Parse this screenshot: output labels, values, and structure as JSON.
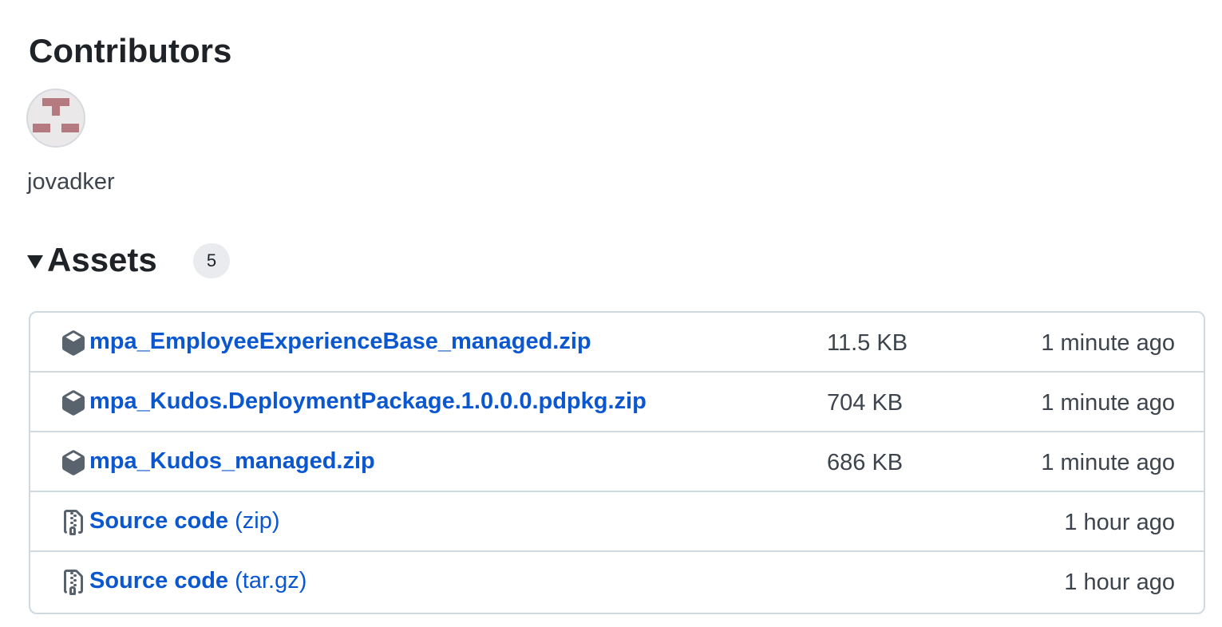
{
  "contributors": {
    "title": "Contributors",
    "people": [
      {
        "username": "jovadker",
        "avatar_icon": "identicon"
      }
    ]
  },
  "assets": {
    "title": "Assets",
    "count": "5",
    "expanded": true,
    "items": [
      {
        "name": "mpa_EmployeeExperienceBase_managed.zip",
        "suffix": "",
        "size": "11.5 KB",
        "time": "1 minute ago",
        "icon": "package-icon"
      },
      {
        "name": "mpa_Kudos.DeploymentPackage.1.0.0.0.pdpkg.zip",
        "suffix": "",
        "size": "704 KB",
        "time": "1 minute ago",
        "icon": "package-icon"
      },
      {
        "name": "mpa_Kudos_managed.zip",
        "suffix": "",
        "size": "686 KB",
        "time": "1 minute ago",
        "icon": "package-icon"
      },
      {
        "name": "Source code",
        "suffix": "(zip)",
        "size": "",
        "time": "1 hour ago",
        "icon": "file-zip-icon"
      },
      {
        "name": "Source code",
        "suffix": "(tar.gz)",
        "size": "",
        "time": "1 hour ago",
        "icon": "file-zip-icon"
      }
    ]
  },
  "colors": {
    "link": "#0b57d0",
    "muted_text": "#3d444d",
    "border": "#d1d9e0",
    "avatar_block": "#b47a80"
  }
}
